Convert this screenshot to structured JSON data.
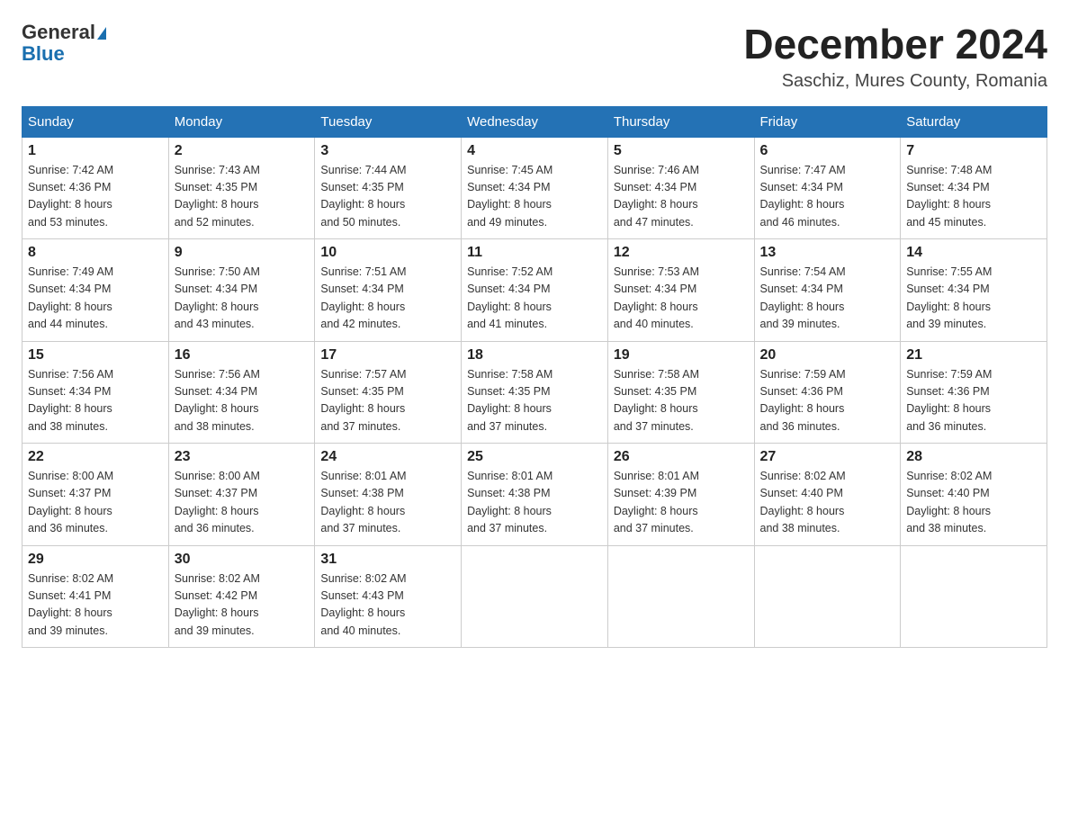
{
  "header": {
    "logo_general": "General",
    "logo_blue": "Blue",
    "month_title": "December 2024",
    "location": "Saschiz, Mures County, Romania"
  },
  "days_of_week": [
    "Sunday",
    "Monday",
    "Tuesday",
    "Wednesday",
    "Thursday",
    "Friday",
    "Saturday"
  ],
  "weeks": [
    [
      {
        "day": "1",
        "sunrise": "7:42 AM",
        "sunset": "4:36 PM",
        "daylight": "8 hours and 53 minutes."
      },
      {
        "day": "2",
        "sunrise": "7:43 AM",
        "sunset": "4:35 PM",
        "daylight": "8 hours and 52 minutes."
      },
      {
        "day": "3",
        "sunrise": "7:44 AM",
        "sunset": "4:35 PM",
        "daylight": "8 hours and 50 minutes."
      },
      {
        "day": "4",
        "sunrise": "7:45 AM",
        "sunset": "4:34 PM",
        "daylight": "8 hours and 49 minutes."
      },
      {
        "day": "5",
        "sunrise": "7:46 AM",
        "sunset": "4:34 PM",
        "daylight": "8 hours and 47 minutes."
      },
      {
        "day": "6",
        "sunrise": "7:47 AM",
        "sunset": "4:34 PM",
        "daylight": "8 hours and 46 minutes."
      },
      {
        "day": "7",
        "sunrise": "7:48 AM",
        "sunset": "4:34 PM",
        "daylight": "8 hours and 45 minutes."
      }
    ],
    [
      {
        "day": "8",
        "sunrise": "7:49 AM",
        "sunset": "4:34 PM",
        "daylight": "8 hours and 44 minutes."
      },
      {
        "day": "9",
        "sunrise": "7:50 AM",
        "sunset": "4:34 PM",
        "daylight": "8 hours and 43 minutes."
      },
      {
        "day": "10",
        "sunrise": "7:51 AM",
        "sunset": "4:34 PM",
        "daylight": "8 hours and 42 minutes."
      },
      {
        "day": "11",
        "sunrise": "7:52 AM",
        "sunset": "4:34 PM",
        "daylight": "8 hours and 41 minutes."
      },
      {
        "day": "12",
        "sunrise": "7:53 AM",
        "sunset": "4:34 PM",
        "daylight": "8 hours and 40 minutes."
      },
      {
        "day": "13",
        "sunrise": "7:54 AM",
        "sunset": "4:34 PM",
        "daylight": "8 hours and 39 minutes."
      },
      {
        "day": "14",
        "sunrise": "7:55 AM",
        "sunset": "4:34 PM",
        "daylight": "8 hours and 39 minutes."
      }
    ],
    [
      {
        "day": "15",
        "sunrise": "7:56 AM",
        "sunset": "4:34 PM",
        "daylight": "8 hours and 38 minutes."
      },
      {
        "day": "16",
        "sunrise": "7:56 AM",
        "sunset": "4:34 PM",
        "daylight": "8 hours and 38 minutes."
      },
      {
        "day": "17",
        "sunrise": "7:57 AM",
        "sunset": "4:35 PM",
        "daylight": "8 hours and 37 minutes."
      },
      {
        "day": "18",
        "sunrise": "7:58 AM",
        "sunset": "4:35 PM",
        "daylight": "8 hours and 37 minutes."
      },
      {
        "day": "19",
        "sunrise": "7:58 AM",
        "sunset": "4:35 PM",
        "daylight": "8 hours and 37 minutes."
      },
      {
        "day": "20",
        "sunrise": "7:59 AM",
        "sunset": "4:36 PM",
        "daylight": "8 hours and 36 minutes."
      },
      {
        "day": "21",
        "sunrise": "7:59 AM",
        "sunset": "4:36 PM",
        "daylight": "8 hours and 36 minutes."
      }
    ],
    [
      {
        "day": "22",
        "sunrise": "8:00 AM",
        "sunset": "4:37 PM",
        "daylight": "8 hours and 36 minutes."
      },
      {
        "day": "23",
        "sunrise": "8:00 AM",
        "sunset": "4:37 PM",
        "daylight": "8 hours and 36 minutes."
      },
      {
        "day": "24",
        "sunrise": "8:01 AM",
        "sunset": "4:38 PM",
        "daylight": "8 hours and 37 minutes."
      },
      {
        "day": "25",
        "sunrise": "8:01 AM",
        "sunset": "4:38 PM",
        "daylight": "8 hours and 37 minutes."
      },
      {
        "day": "26",
        "sunrise": "8:01 AM",
        "sunset": "4:39 PM",
        "daylight": "8 hours and 37 minutes."
      },
      {
        "day": "27",
        "sunrise": "8:02 AM",
        "sunset": "4:40 PM",
        "daylight": "8 hours and 38 minutes."
      },
      {
        "day": "28",
        "sunrise": "8:02 AM",
        "sunset": "4:40 PM",
        "daylight": "8 hours and 38 minutes."
      }
    ],
    [
      {
        "day": "29",
        "sunrise": "8:02 AM",
        "sunset": "4:41 PM",
        "daylight": "8 hours and 39 minutes."
      },
      {
        "day": "30",
        "sunrise": "8:02 AM",
        "sunset": "4:42 PM",
        "daylight": "8 hours and 39 minutes."
      },
      {
        "day": "31",
        "sunrise": "8:02 AM",
        "sunset": "4:43 PM",
        "daylight": "8 hours and 40 minutes."
      },
      null,
      null,
      null,
      null
    ]
  ],
  "labels": {
    "sunrise": "Sunrise:",
    "sunset": "Sunset:",
    "daylight": "Daylight:"
  }
}
